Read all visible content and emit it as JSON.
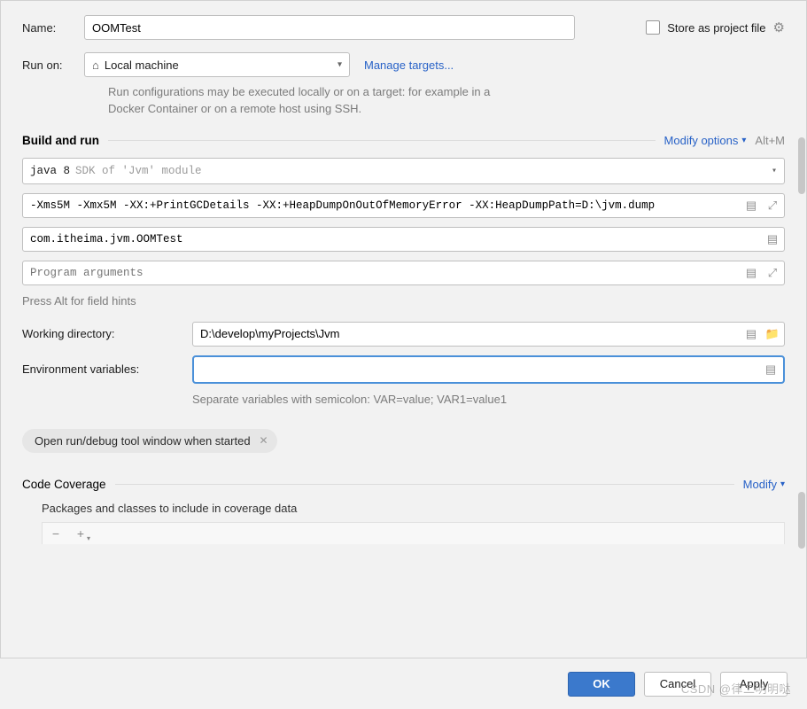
{
  "header": {
    "name_label": "Name:",
    "name_value": "OOMTest",
    "store_label": "Store as project file"
  },
  "runon": {
    "label": "Run on:",
    "value": "Local machine",
    "manage_link": "Manage targets...",
    "hint": "Run configurations may be executed locally or on a target: for example in a Docker Container or on a remote host using SSH."
  },
  "build": {
    "title": "Build and run",
    "modify": "Modify options",
    "shortcut": "Alt+M",
    "jdk_value": "java 8",
    "jdk_module": "SDK of 'Jvm' module",
    "vm_options": "-Xms5M -Xmx5M -XX:+PrintGCDetails -XX:+HeapDumpOnOutOfMemoryError -XX:HeapDumpPath=D:\\jvm.dump",
    "main_class": "com.itheima.jvm.OOMTest",
    "program_args_ph": "Program arguments",
    "hint_press": "Press Alt for field hints",
    "wd_label": "Working directory:",
    "wd_value": "D:\\develop\\myProjects\\Jvm",
    "env_label": "Environment variables:",
    "env_value": "",
    "env_hint": "Separate variables with semicolon: VAR=value; VAR1=value1",
    "chip": "Open run/debug tool window when started"
  },
  "coverage": {
    "title": "Code Coverage",
    "modify": "Modify",
    "sub": "Packages and classes to include in coverage data"
  },
  "buttons": {
    "ok": "OK",
    "cancel": "Cancel",
    "apply": "Apply"
  },
  "watermark": "CSDN @律二明明哒"
}
